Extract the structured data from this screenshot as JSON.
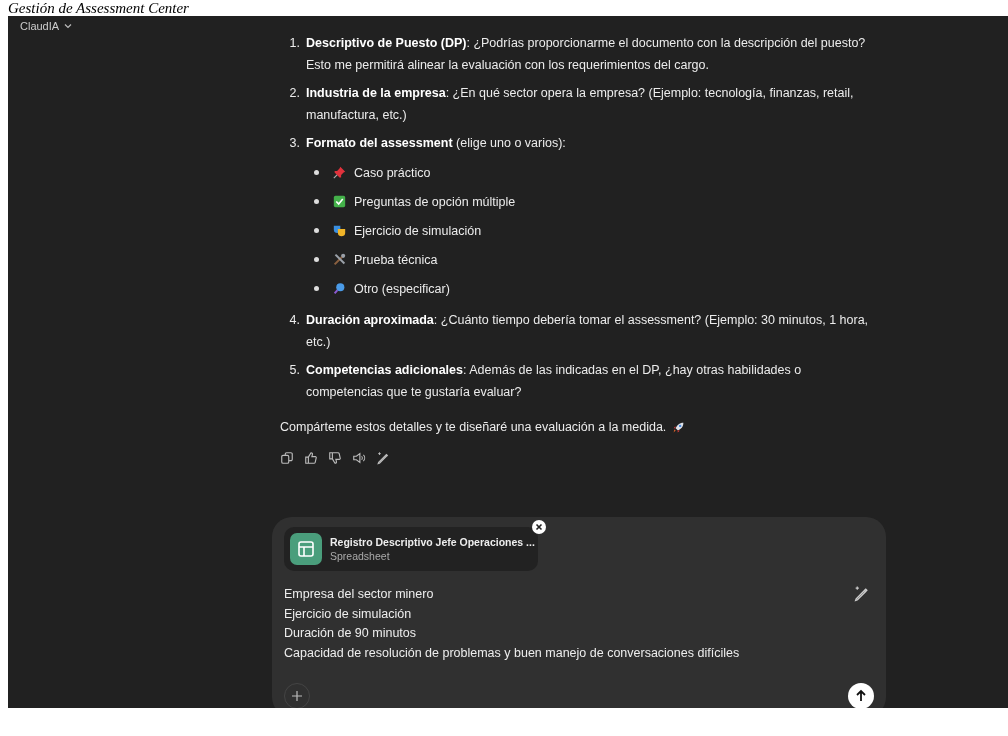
{
  "page_heading": "Gestión de Assessment Center",
  "model_menu": {
    "label": "ClaudIA"
  },
  "message": {
    "items": [
      {
        "number": "1.",
        "text": "**Descriptivo de Puesto (DP)**: ¿Podrías proporcionarme el documento con la descripción del puesto? Esto me permitirá alinear la evaluación con los requerimientos del cargo."
      },
      {
        "number": "2.",
        "text": "**Industria de la empresa**: ¿En qué sector opera la empresa? (Ejemplo: tecnología, finanzas, retail, manufactura, etc.)"
      },
      {
        "number": "3.",
        "text": "**Formato del assessment** (elige uno o varios):",
        "bullets": [
          {
            "kind": "pin",
            "label": "Caso práctico"
          },
          {
            "kind": "check",
            "label": "Preguntas de opción múltiple"
          },
          {
            "kind": "masks",
            "label": "Ejercicio de simulación"
          },
          {
            "kind": "tools",
            "label": "Prueba técnica"
          },
          {
            "kind": "magnifier",
            "label": "Otro (especificar)"
          }
        ]
      },
      {
        "number": "4.",
        "text": "**Duración aproximada**: ¿Cuánto tiempo debería tomar el assessment? (Ejemplo: 30 minutos, 1 hora, etc.)"
      },
      {
        "number": "5.",
        "text": "**Competencias adicionales**: Además de las indicadas en el DP, ¿hay otras habilidades o competencias que te gustaría evaluar?"
      }
    ],
    "closing": "Compárteme estos detalles y te diseñaré una evaluación a la medida."
  },
  "composer": {
    "attachment": {
      "name": "Registro Descriptivo Jefe Operaciones ...",
      "type": "Spreadsheet"
    },
    "value": "Empresa del sector minero\nEjercicio de simulación\nDuración de 90 minutos\nCapacidad de resolución de problemas y buen manejo de conversaciones difíciles"
  }
}
